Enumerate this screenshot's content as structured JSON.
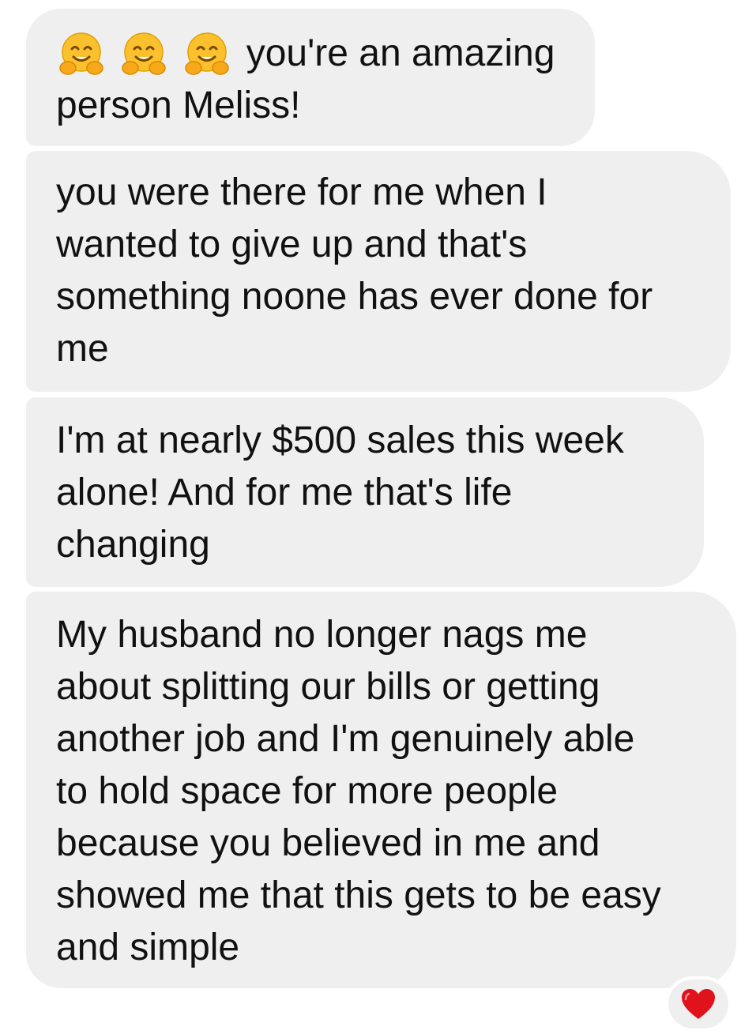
{
  "messages": [
    {
      "emoji": [
        "hugging-face",
        "hugging-face",
        "hugging-face"
      ],
      "lines": [
        "you're an amazing",
        "person Meliss!"
      ]
    },
    {
      "lines": [
        "you were there for me when I",
        "wanted to give up and that's",
        "something noone has ever done for",
        "me"
      ]
    },
    {
      "lines": [
        "I'm at nearly $500 sales this week",
        "alone! And for me that's life",
        "changing"
      ]
    },
    {
      "lines": [
        "My husband no longer nags me",
        "about splitting our bills or getting",
        "another job and I'm genuinely able",
        "to hold space for more people",
        "because you believed in me and",
        "showed me that this gets to be easy",
        "and simple"
      ]
    }
  ],
  "reaction": {
    "icon": "heart",
    "color": "#e0121b"
  },
  "colors": {
    "bubble": "#efefef",
    "text": "#111111",
    "emoji_face": "#fbc02d"
  }
}
